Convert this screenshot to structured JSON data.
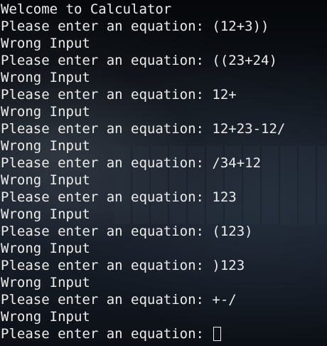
{
  "terminal": {
    "lines": [
      "Welcome to Calculator",
      "Please enter an equation: (12+3))",
      "Wrong Input",
      "Please enter an equation: ((23+24)",
      "Wrong Input",
      "Please enter an equation: 12+",
      "Wrong Input",
      "Please enter an equation: 12+23-12/",
      "Wrong Input",
      "Please enter an equation: /34+12",
      "Wrong Input",
      "Please enter an equation: 123",
      "Wrong Input",
      "Please enter an equation: (123)",
      "Wrong Input",
      "Please enter an equation: )123",
      "Wrong Input",
      "Please enter an equation: +-/",
      "Wrong Input"
    ],
    "prompt": "Please enter an equation: ",
    "cursor_icon": "block-cursor-icon",
    "text_color": "#ececec",
    "background_color": "#0d1118"
  }
}
